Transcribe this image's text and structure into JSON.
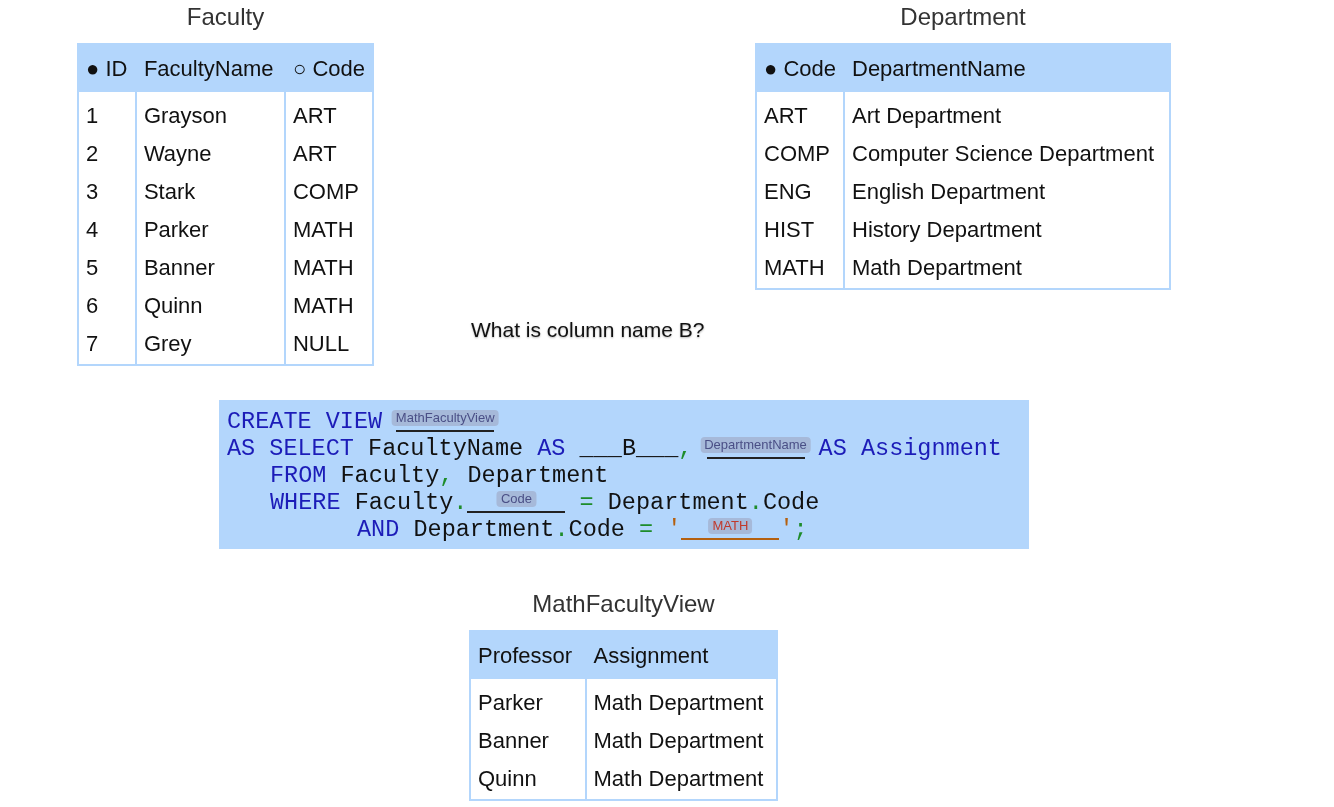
{
  "faculty": {
    "title": "Faculty",
    "columns": [
      "● ID",
      "FacultyName",
      "○ Code"
    ],
    "rows": [
      [
        "1",
        "Grayson",
        "ART"
      ],
      [
        "2",
        "Wayne",
        "ART"
      ],
      [
        "3",
        "Stark",
        "COMP"
      ],
      [
        "4",
        "Parker",
        "MATH"
      ],
      [
        "5",
        "Banner",
        "MATH"
      ],
      [
        "6",
        "Quinn",
        "MATH"
      ],
      [
        "7",
        "Grey",
        "NULL"
      ]
    ]
  },
  "department": {
    "title": "Department",
    "columns": [
      "● Code",
      "DepartmentName"
    ],
    "rows": [
      [
        "ART",
        "Art Department"
      ],
      [
        "COMP",
        "Computer Science Department"
      ],
      [
        "ENG",
        "English Department"
      ],
      [
        "HIST",
        "History Department"
      ],
      [
        "MATH",
        "Math Department"
      ]
    ]
  },
  "question": "What is column name B?",
  "code": [
    {
      "kind": "top",
      "tokens": [
        {
          "kind": "keyword",
          "text": "CREATE VIEW "
        },
        {
          "kind": "blank",
          "answer": "MathFacultyView"
        }
      ]
    },
    {
      "kind": "top",
      "tokens": [
        {
          "kind": "keyword",
          "text": "AS SELECT "
        },
        {
          "kind": "plain",
          "text": "FacultyName "
        },
        {
          "kind": "keyword",
          "text": "AS "
        },
        {
          "kind": "plain",
          "text": "___B___"
        },
        {
          "kind": "punct",
          "text": ", "
        },
        {
          "kind": "blank",
          "answer": "DepartmentName"
        },
        {
          "kind": "keyword",
          "text": " AS Assignment"
        }
      ]
    },
    {
      "kind": "clause",
      "tokens": [
        {
          "kind": "keyword",
          "text": "FROM "
        },
        {
          "kind": "plain",
          "text": "Faculty"
        },
        {
          "kind": "punct",
          "text": ", "
        },
        {
          "kind": "plain",
          "text": "Department"
        }
      ]
    },
    {
      "kind": "clause",
      "tokens": [
        {
          "kind": "keyword",
          "text": "WHERE "
        },
        {
          "kind": "plain",
          "text": "Faculty"
        },
        {
          "kind": "punct",
          "text": "."
        },
        {
          "kind": "blank",
          "answer": "Code"
        },
        {
          "kind": "punct",
          "text": " = "
        },
        {
          "kind": "plain",
          "text": "Department"
        },
        {
          "kind": "punct",
          "text": "."
        },
        {
          "kind": "plain",
          "text": "Code"
        }
      ]
    },
    {
      "kind": "condition",
      "tokens": [
        {
          "kind": "keyword",
          "text": "AND "
        },
        {
          "kind": "plain",
          "text": "Department"
        },
        {
          "kind": "punct",
          "text": "."
        },
        {
          "kind": "plain",
          "text": "Code "
        },
        {
          "kind": "punct",
          "text": "= "
        },
        {
          "kind": "string",
          "text": "'"
        },
        {
          "kind": "string_blank",
          "answer": "MATH"
        },
        {
          "kind": "string",
          "text": "'"
        },
        {
          "kind": "punct",
          "text": ";"
        }
      ]
    }
  ],
  "view": {
    "title": "MathFacultyView",
    "columns": [
      "Professor",
      "Assignment"
    ],
    "rows": [
      [
        "Parker",
        "Math Department"
      ],
      [
        "Banner",
        "Math Department"
      ],
      [
        "Quinn",
        "Math Department"
      ]
    ]
  }
}
